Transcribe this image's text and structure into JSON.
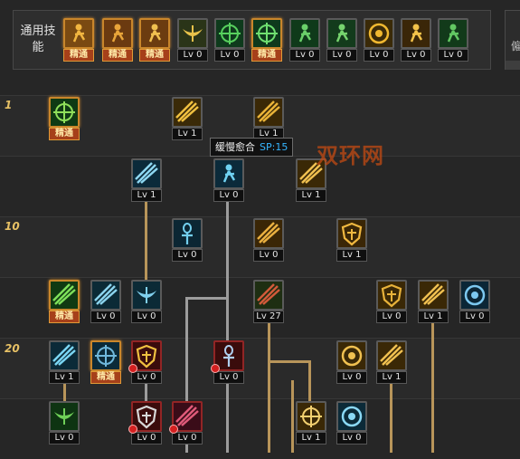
{
  "general_section": {
    "label": "通用技能",
    "skills": [
      {
        "icon": "running-figure-icon",
        "level": "精通",
        "master": true
      },
      {
        "icon": "kneeling-figure-icon",
        "level": "精通",
        "master": true
      },
      {
        "icon": "dash-figure-icon",
        "level": "精通",
        "master": true
      },
      {
        "icon": "wings-icon",
        "level": "Lv 0",
        "master": false
      },
      {
        "icon": "crosshair-icon",
        "level": "Lv 0",
        "master": false
      },
      {
        "icon": "crosshair-burst-icon",
        "level": "精通",
        "master": true
      },
      {
        "icon": "leap-figure-icon",
        "level": "Lv 0",
        "master": false
      },
      {
        "icon": "lotus-figure-icon",
        "level": "Lv 0",
        "master": false
      },
      {
        "icon": "eye-ring-icon",
        "level": "Lv 0",
        "master": false
      },
      {
        "icon": "guardian-figure-icon",
        "level": "Lv 0",
        "master": false
      },
      {
        "icon": "document-figure-icon",
        "level": "Lv 0",
        "master": false
      }
    ]
  },
  "side_panel": {
    "text": "僱"
  },
  "row_labels": [
    "1",
    "10",
    "20"
  ],
  "tooltip": {
    "name": "缓慢愈合",
    "sp": "SP:15"
  },
  "watermark": "双环网",
  "colors": {
    "master_border": "#c9862b",
    "level_gold": "#e6c065",
    "sp_blue": "#36b6ff",
    "connector": "#b8955a"
  },
  "tree_skills": [
    {
      "icon": "green-cross-icon",
      "level": "精通",
      "master": true
    },
    {
      "icon": "speed-dash-icon",
      "level": "Lv 1"
    },
    {
      "icon": "claw-slash-icon",
      "level": "Lv 1"
    },
    {
      "icon": "crossed-swords-icon",
      "level": "Lv 1"
    },
    {
      "icon": "healing-hand-icon",
      "level": "Lv 0"
    },
    {
      "icon": "sword-slash-icon",
      "level": "Lv 1"
    },
    {
      "icon": "ankh-icon",
      "level": "Lv 0"
    },
    {
      "icon": "golden-slash-icon",
      "level": "Lv 0"
    },
    {
      "icon": "shield-crest-icon",
      "level": "Lv 1"
    },
    {
      "icon": "green-feather-icon",
      "level": "精通",
      "master": true
    },
    {
      "icon": "triple-blade-icon",
      "level": "Lv 0"
    },
    {
      "icon": "wing-arc-icon",
      "level": "Lv 0"
    },
    {
      "icon": "sword-cross-icon",
      "level": "Lv 27"
    },
    {
      "icon": "torii-gate-icon",
      "level": "Lv 0"
    },
    {
      "icon": "spear-thrust-icon",
      "level": "Lv 1"
    },
    {
      "icon": "blue-mask-icon",
      "level": "Lv 0"
    },
    {
      "icon": "spiral-bolt-icon",
      "level": "Lv 1"
    },
    {
      "icon": "shattered-crystal-icon",
      "level": "精通",
      "master": true
    },
    {
      "icon": "red-shield-icon",
      "level": "Lv 0",
      "locked": true
    },
    {
      "icon": "music-note-icon",
      "level": "Lv 0",
      "locked": true
    },
    {
      "icon": "golden-vortex-icon",
      "level": "Lv 0"
    },
    {
      "icon": "lightning-sword-icon",
      "level": "Lv 1"
    },
    {
      "icon": "green-boot-icon",
      "level": "Lv 0"
    },
    {
      "icon": "cross-shield-icon",
      "level": "Lv 0",
      "locked": true
    },
    {
      "icon": "meteor-icon",
      "level": "Lv 0",
      "locked": true
    },
    {
      "icon": "holy-cross-icon",
      "level": "Lv 1"
    },
    {
      "icon": "blue-swirl-icon",
      "level": "Lv 0"
    }
  ]
}
